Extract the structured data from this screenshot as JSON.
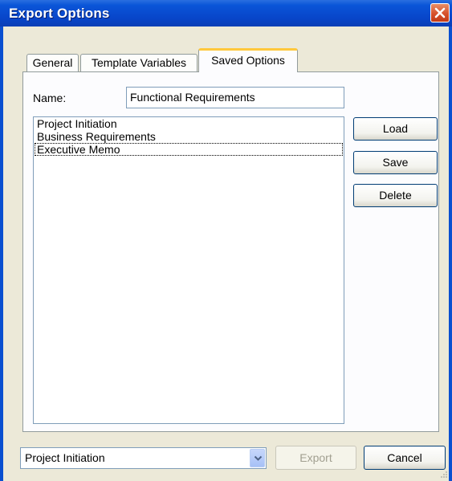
{
  "window": {
    "title": "Export Options"
  },
  "tabs": [
    {
      "label": "General"
    },
    {
      "label": "Template Variables"
    },
    {
      "label": "Saved Options"
    }
  ],
  "name_field": {
    "label": "Name:",
    "value": "Functional Requirements"
  },
  "saved_list": {
    "items": [
      "Project Initiation",
      "Business Requirements",
      "Executive Memo"
    ],
    "focused_index": 2
  },
  "side_buttons": {
    "load": "Load",
    "save": "Save",
    "delete": "Delete"
  },
  "footer": {
    "template_select": "Project Initiation",
    "export": "Export",
    "cancel": "Cancel"
  },
  "icons": {
    "close": "close-icon",
    "dropdown": "chevron-down-icon",
    "grip": "resize-grip-icon"
  }
}
